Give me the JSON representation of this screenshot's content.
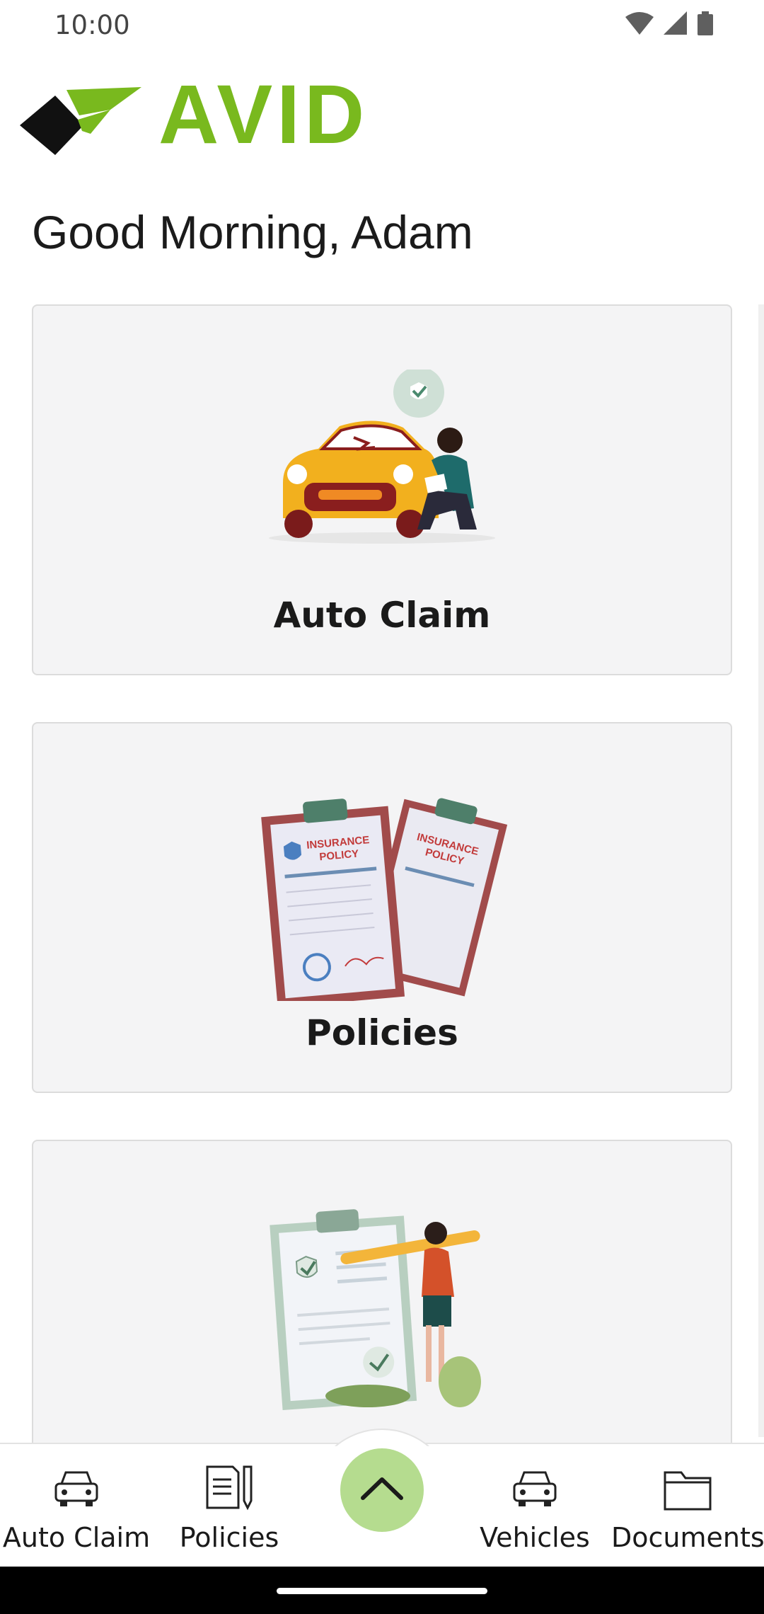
{
  "status": {
    "time": "10:00"
  },
  "brand": {
    "name": "AVID",
    "accent": "#79b91e"
  },
  "greeting": "Good Morning, Adam",
  "cards": [
    {
      "title": "Auto Claim",
      "icon": "car-accident-illustration"
    },
    {
      "title": "Policies",
      "icon": "insurance-policy-illustration"
    },
    {
      "title": "",
      "icon": "checklist-illustration"
    }
  ],
  "nav": {
    "items": [
      {
        "label": "Auto Claim",
        "icon": "car-icon"
      },
      {
        "label": "Policies",
        "icon": "document-pen-icon"
      },
      {
        "label": "Vehicles",
        "icon": "car-icon"
      },
      {
        "label": "Documents",
        "icon": "folder-icon"
      }
    ],
    "fab_icon": "chevron-up-icon",
    "fab_color": "#b5dc8f"
  }
}
